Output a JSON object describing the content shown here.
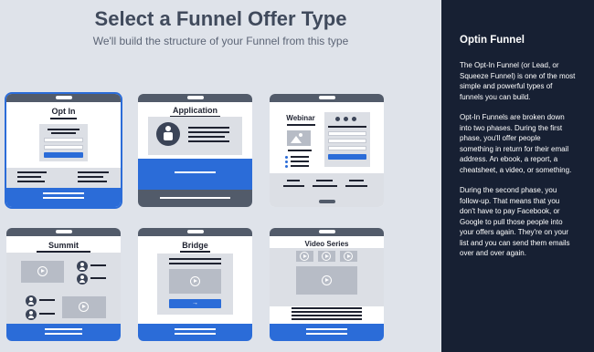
{
  "header": {
    "title": "Select a Funnel Offer Type",
    "subtitle": "We'll build the structure of your Funnel from this type"
  },
  "cards": [
    {
      "title": "Opt In",
      "selected": true
    },
    {
      "title": "Application",
      "selected": false
    },
    {
      "title": "Webinar",
      "selected": false
    },
    {
      "title": "Summit",
      "selected": false
    },
    {
      "title": "Bridge",
      "selected": false
    },
    {
      "title": "Video Series",
      "selected": false
    }
  ],
  "sidebar": {
    "title": "Optin Funnel",
    "paragraphs": [
      "The Opt-In Funnel (or Lead, or Squeeze Funnel) is one of the most simple and powerful types of funnels you can build.",
      "Opt-In Funnels are broken down into two phases. During the first phase, you'll offer people something in return for their email address. An ebook, a report, a cheatsheet, a video, or something.",
      "During the second phase, you follow-up. That means that you don't have to pay Facebook, or Google to pull those people into your offers again. They're on your list and you can send them emails over and over again."
    ]
  },
  "colors": {
    "accent": "#2b6cd8",
    "sidebar_bg": "#172033",
    "page_bg": "#dfe3ea",
    "card_bar": "#525b6a"
  }
}
